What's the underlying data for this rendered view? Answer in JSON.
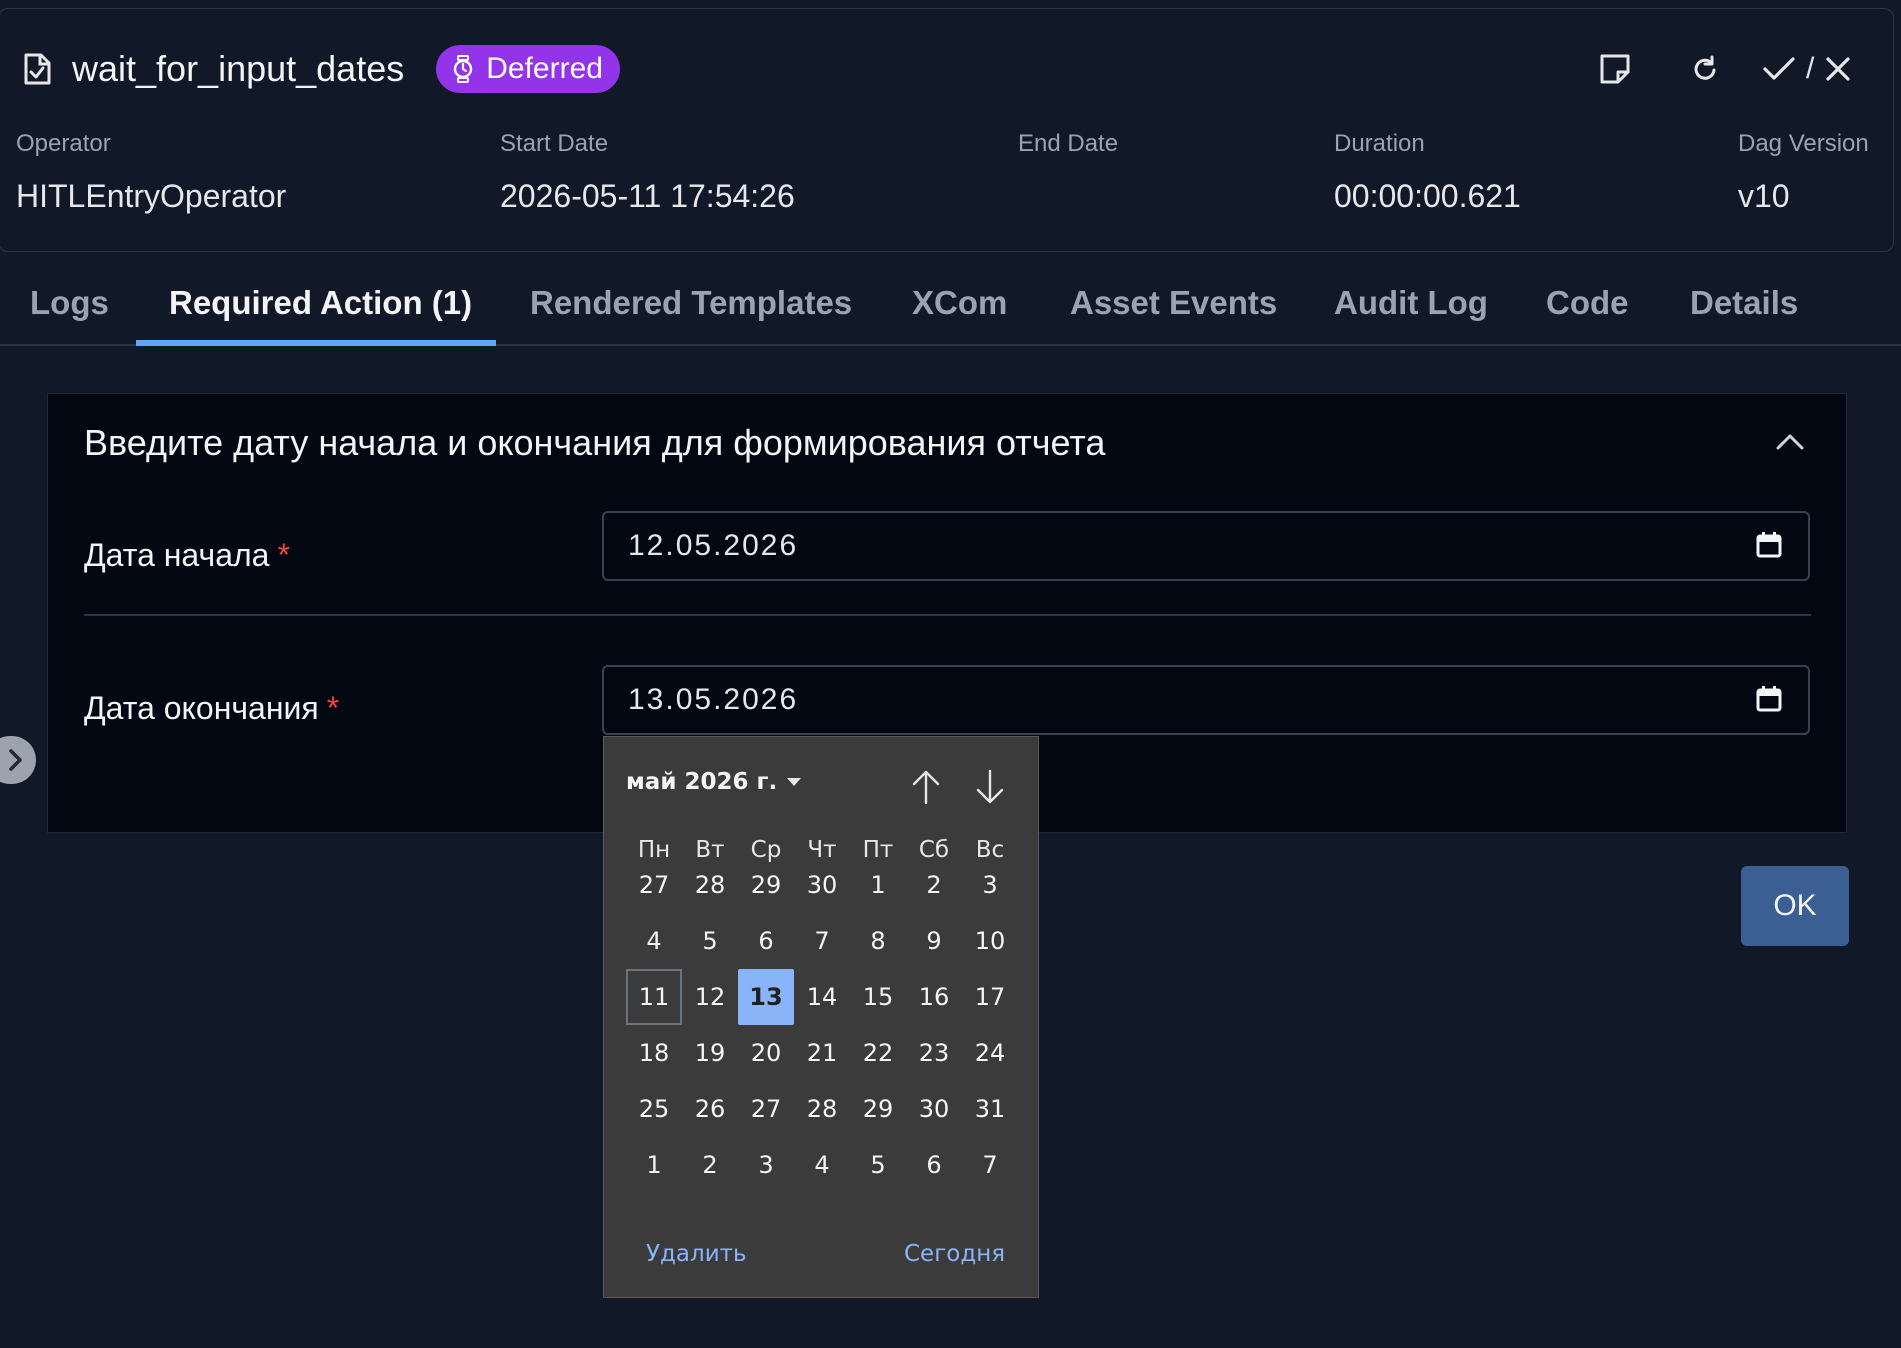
{
  "header": {
    "task_name": "wait_for_input_dates",
    "state_badge": "Deferred",
    "confirm_separator": "/",
    "meta": [
      {
        "label": "Operator",
        "value": "HITLEntryOperator"
      },
      {
        "label": "Start Date",
        "value": "2026-05-11 17:54:26"
      },
      {
        "label": "End Date",
        "value": ""
      },
      {
        "label": "Duration",
        "value": "00:00:00.621"
      },
      {
        "label": "Dag Version",
        "value": "v10"
      }
    ]
  },
  "tabs": [
    "Logs",
    "Required Action (1)",
    "Rendered Templates",
    "XCom",
    "Asset Events",
    "Audit Log",
    "Code",
    "Details"
  ],
  "active_tab": "Required Action (1)",
  "form": {
    "heading": "Введите дату начала и окончания для формирования отчета",
    "required_mark": "*",
    "start_label": "Дата начала",
    "start_value": "12.05.2026",
    "end_label": "Дата окончания",
    "end_value": "13.05.2026",
    "ok_label": "OK"
  },
  "date_picker": {
    "month_label": "май 2026 г.",
    "weekdays": [
      "Пн",
      "Вт",
      "Ср",
      "Чт",
      "Пт",
      "Сб",
      "Вс"
    ],
    "weeks": [
      [
        "27",
        "28",
        "29",
        "30",
        "1",
        "2",
        "3"
      ],
      [
        "4",
        "5",
        "6",
        "7",
        "8",
        "9",
        "10"
      ],
      [
        "11",
        "12",
        "13",
        "14",
        "15",
        "16",
        "17"
      ],
      [
        "18",
        "19",
        "20",
        "21",
        "22",
        "23",
        "24"
      ],
      [
        "25",
        "26",
        "27",
        "28",
        "29",
        "30",
        "31"
      ],
      [
        "1",
        "2",
        "3",
        "4",
        "5",
        "6",
        "7"
      ]
    ],
    "today_day": "11",
    "selected_day": "13",
    "clear_label": "Удалить",
    "today_label": "Сегодня"
  },
  "colors": {
    "background": "#111827",
    "badge": "#9333ea",
    "tab_accent": "#60a5fa",
    "required": "#ef4444",
    "ok_button": "#3b5f93",
    "picker_selected": "#8ab4f8"
  },
  "icons": [
    "document-check-icon",
    "timer-icon",
    "note-icon",
    "refresh-icon",
    "check-icon",
    "close-icon",
    "chevron-up-icon",
    "calendar-icon",
    "chevron-right-icon",
    "arrow-up-icon",
    "arrow-down-icon"
  ]
}
